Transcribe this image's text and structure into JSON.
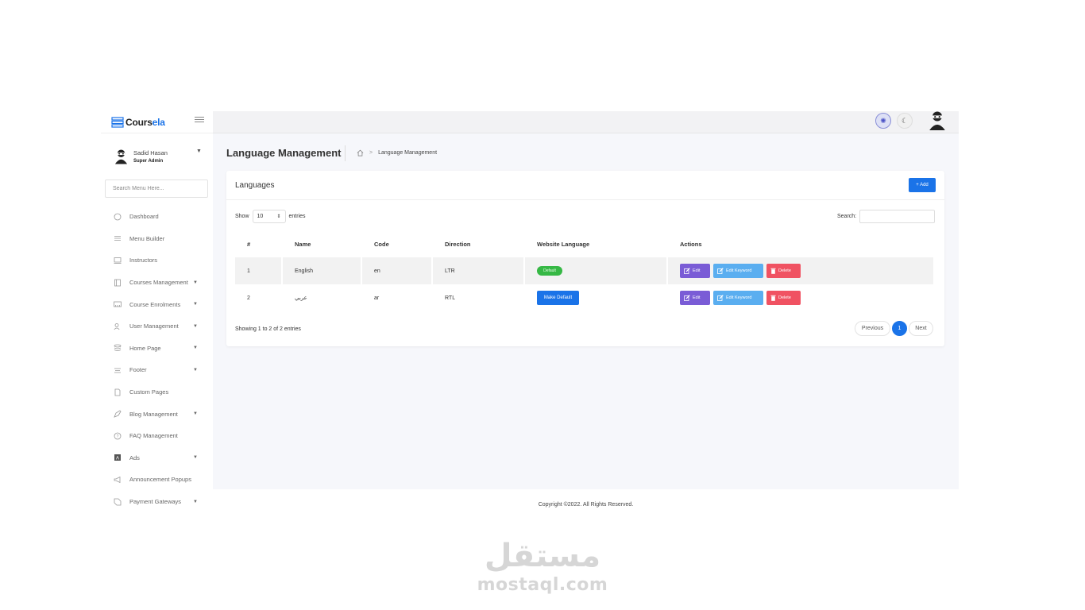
{
  "app": {
    "brand_prefix": "Cours",
    "brand_suffix": "ela",
    "brand_accent": "#1a73e8"
  },
  "user": {
    "name": "Sadid Hasan",
    "role": "Super Admin"
  },
  "sidebar": {
    "search_placeholder": "Search Menu Here...",
    "items": [
      {
        "label": "Dashboard",
        "icon": "dashboard-icon",
        "has_submenu": false
      },
      {
        "label": "Menu Builder",
        "icon": "menu-icon",
        "has_submenu": false
      },
      {
        "label": "Instructors",
        "icon": "instructor-icon",
        "has_submenu": false
      },
      {
        "label": "Courses Management",
        "icon": "book-icon",
        "has_submenu": true
      },
      {
        "label": "Course Enrolments",
        "icon": "enrolment-icon",
        "has_submenu": true
      },
      {
        "label": "User Management",
        "icon": "users-icon",
        "has_submenu": true
      },
      {
        "label": "Home Page",
        "icon": "layers-icon",
        "has_submenu": true
      },
      {
        "label": "Footer",
        "icon": "footer-icon",
        "has_submenu": true
      },
      {
        "label": "Custom Pages",
        "icon": "page-icon",
        "has_submenu": false
      },
      {
        "label": "Blog Management",
        "icon": "blog-icon",
        "has_submenu": true
      },
      {
        "label": "FAQ Management",
        "icon": "question-icon",
        "has_submenu": false
      },
      {
        "label": "Ads",
        "icon": "ads-icon",
        "has_submenu": true
      },
      {
        "label": "Announcement Popups",
        "icon": "megaphone-icon",
        "has_submenu": false
      },
      {
        "label": "Payment Gateways",
        "icon": "payment-icon",
        "has_submenu": true
      }
    ]
  },
  "page": {
    "title": "Language Management",
    "breadcrumb_current": "Language Management"
  },
  "card": {
    "title": "Languages",
    "add_label": "+ Add",
    "show_label": "Show",
    "entries_value": "10",
    "entries_label": "entries",
    "search_label": "Search:",
    "columns": [
      "#",
      "Name",
      "Code",
      "Direction",
      "Website Language",
      "Actions"
    ],
    "rows": [
      {
        "num": "1",
        "name": "English",
        "code": "en",
        "direction": "LTR",
        "website_language": "Default",
        "is_default": true
      },
      {
        "num": "2",
        "name": "عربي",
        "code": "ar",
        "direction": "RTL",
        "website_language": "Make Default",
        "is_default": false
      }
    ],
    "actions": {
      "edit": "Edit",
      "edit_keyword": "Edit Keyword",
      "delete": "Delete"
    },
    "info": "Showing 1 to 2 of 2 entries",
    "pagination": {
      "previous": "Previous",
      "current": "1",
      "next": "Next"
    }
  },
  "footer": {
    "text": "Copyright ©2022. All Rights Reserved."
  },
  "watermark": {
    "arabic": "مستقل",
    "latin": "mostaql.com"
  },
  "colors": {
    "primary": "#1a73e8",
    "edit": "#7a5cd6",
    "edit_keyword": "#5aaef0",
    "delete": "#f05262",
    "default_badge": "#36b845"
  }
}
